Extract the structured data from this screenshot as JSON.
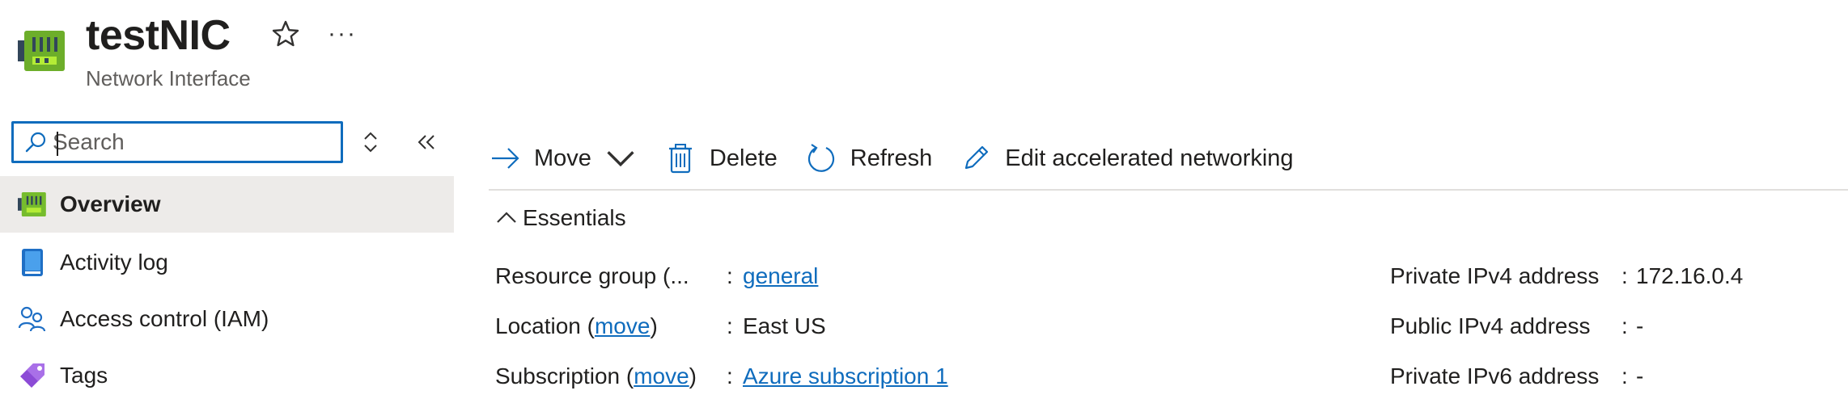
{
  "header": {
    "title": "testNIC",
    "subtitle": "Network Interface",
    "more_label": "···"
  },
  "sidebar": {
    "search": {
      "value": "",
      "placeholder": "Search"
    },
    "items": [
      {
        "label": "Overview",
        "icon": "network-interface-icon",
        "active": true
      },
      {
        "label": "Activity log",
        "icon": "activity-log-icon",
        "active": false
      },
      {
        "label": "Access control (IAM)",
        "icon": "iam-people-icon",
        "active": false
      },
      {
        "label": "Tags",
        "icon": "tag-icon",
        "active": false
      }
    ]
  },
  "toolbar": {
    "move_label": "Move",
    "delete_label": "Delete",
    "refresh_label": "Refresh",
    "edit_label": "Edit accelerated networking"
  },
  "essentials": {
    "heading": "Essentials",
    "left": [
      {
        "label": "Resource group (",
        "link": "",
        "label_suffix": "...",
        "value": "general",
        "value_is_link": true
      },
      {
        "label": "Location (",
        "link": "move",
        "label_suffix": ")",
        "value": "East US",
        "value_is_link": false
      },
      {
        "label": "Subscription (",
        "link": "move",
        "label_suffix": ")",
        "value": "Azure subscription 1",
        "value_is_link": true
      }
    ],
    "right": [
      {
        "label": "Private IPv4 address",
        "value": "172.16.0.4"
      },
      {
        "label": "Public IPv4 address",
        "value": "-"
      },
      {
        "label": "Private IPv6 address",
        "value": "-"
      }
    ],
    "separator": ":"
  },
  "colors": {
    "accent": "#0f6cbd",
    "selected_bg": "#edebe9",
    "text": "#201f1e"
  }
}
